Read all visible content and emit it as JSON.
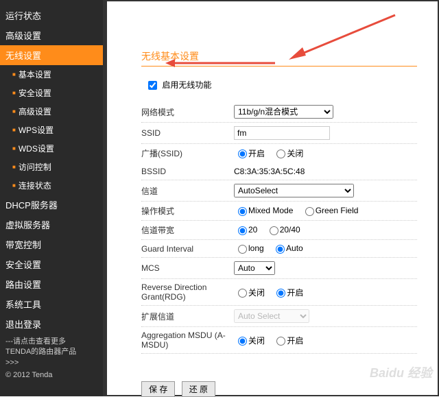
{
  "sidebar": {
    "items": [
      {
        "label": "运行状态",
        "sub": false,
        "sel": false
      },
      {
        "label": "高级设置",
        "sub": false,
        "sel": false
      },
      {
        "label": "无线设置",
        "sub": false,
        "sel": true
      },
      {
        "label": "基本设置",
        "sub": true,
        "sel": false
      },
      {
        "label": "安全设置",
        "sub": true,
        "sel": false
      },
      {
        "label": "高级设置",
        "sub": true,
        "sel": false
      },
      {
        "label": "WPS设置",
        "sub": true,
        "sel": false
      },
      {
        "label": "WDS设置",
        "sub": true,
        "sel": false
      },
      {
        "label": "访问控制",
        "sub": true,
        "sel": false
      },
      {
        "label": "连接状态",
        "sub": true,
        "sel": false
      },
      {
        "label": "DHCP服务器",
        "sub": false,
        "sel": false
      },
      {
        "label": "虚拟服务器",
        "sub": false,
        "sel": false
      },
      {
        "label": "带宽控制",
        "sub": false,
        "sel": false
      },
      {
        "label": "安全设置",
        "sub": false,
        "sel": false
      },
      {
        "label": "路由设置",
        "sub": false,
        "sel": false
      },
      {
        "label": "系统工具",
        "sub": false,
        "sel": false
      },
      {
        "label": "退出登录",
        "sub": false,
        "sel": false
      }
    ],
    "footer1": "---请点击查看更多",
    "footer2": "TENDA的路由器产品",
    "footer3": ">>>",
    "copyright": "© 2012 Tenda"
  },
  "main": {
    "section_title": "无线基本设置",
    "enable_label": "启用无线功能",
    "rows": {
      "netmode": {
        "label": "网络模式",
        "value": "11b/g/n混合模式"
      },
      "ssid": {
        "label": "SSID",
        "value": "fm"
      },
      "broadcast": {
        "label": "广播(SSID)",
        "opt1": "开启",
        "opt2": "关闭"
      },
      "bssid": {
        "label": "BSSID",
        "value": "C8:3A:35:3A:5C:48"
      },
      "channel": {
        "label": "信道",
        "value": "AutoSelect"
      },
      "opmode": {
        "label": "操作模式",
        "opt1": "Mixed Mode",
        "opt2": "Green Field"
      },
      "bw": {
        "label": "信道带宽",
        "opt1": "20",
        "opt2": "20/40"
      },
      "gi": {
        "label": "Guard Interval",
        "opt1": "long",
        "opt2": "Auto"
      },
      "mcs": {
        "label": "MCS",
        "value": "Auto"
      },
      "rdg": {
        "label": "Reverse Direction Grant(RDG)",
        "opt1": "关闭",
        "opt2": "开启"
      },
      "extch": {
        "label": "扩展信道",
        "value": "Auto Select"
      },
      "amsdu": {
        "label": "Aggregation MSDU (A-MSDU)",
        "opt1": "关闭",
        "opt2": "开启"
      }
    },
    "buttons": {
      "save": "保 存",
      "restore": "还 原"
    }
  },
  "watermark": "Baidu 经验"
}
